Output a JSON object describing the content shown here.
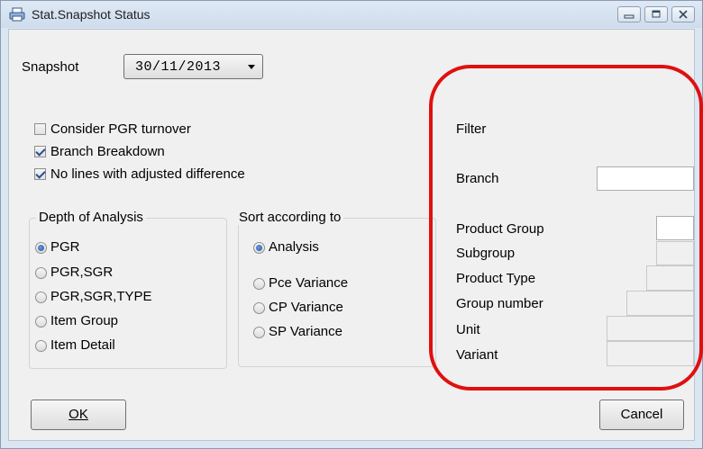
{
  "window": {
    "title": "Stat.Snapshot Status",
    "controls": [
      "minimize",
      "maximize",
      "close"
    ]
  },
  "snapshot": {
    "label": "Snapshot",
    "value": "30/11/2013"
  },
  "options": [
    {
      "label": "Consider PGR turnover",
      "checked": false
    },
    {
      "label": "Branch Breakdown",
      "checked": true
    },
    {
      "label": "No lines with adjusted difference",
      "checked": true
    }
  ],
  "depth": {
    "title": "Depth of Analysis",
    "items": [
      "PGR",
      "PGR,SGR",
      "PGR,SGR,TYPE",
      "Item Group",
      "Item Detail"
    ],
    "selected": "PGR"
  },
  "sort": {
    "title": "Sort according to",
    "items": [
      "Analysis",
      "Pce Variance",
      "CP Variance",
      "SP Variance"
    ],
    "selected": "Analysis"
  },
  "filter": {
    "title": "Filter",
    "branch_label": "Branch",
    "fields": [
      "Product Group",
      "Subgroup",
      "Product Type",
      "Group number",
      "Unit",
      "Variant"
    ]
  },
  "buttons": {
    "ok": "OK",
    "cancel": "Cancel"
  },
  "colors": {
    "highlight": "#e01010",
    "window_frame": "#dbe6f3",
    "client_bg": "#f0f0f0"
  }
}
